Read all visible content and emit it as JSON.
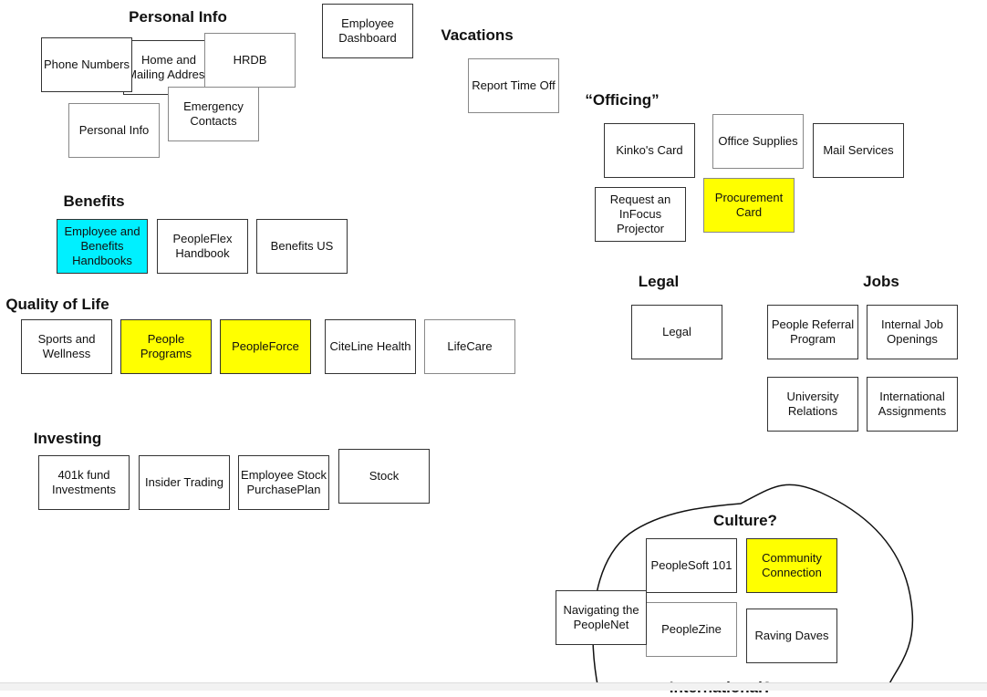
{
  "headings": {
    "personal_info": "Personal Info",
    "vacations": "Vacations",
    "officing": "“Officing”",
    "benefits": "Benefits",
    "quality_of_life": "Quality of Life",
    "investing": "Investing",
    "legal": "Legal",
    "jobs": "Jobs",
    "culture": "Culture?",
    "international": "International?"
  },
  "cards": {
    "home_mailing": "Home and Mailing Address",
    "emergency": "Emergency Contacts",
    "phone": "Phone Numbers",
    "hrdb": "HRDB",
    "personal_info": "Personal Info",
    "employee_dashboard": "Employee Dashboard",
    "report_time_off": "Report Time Off",
    "kinkos": "Kinko's Card",
    "office_supplies": "Office Supplies",
    "mail_services": "Mail Services",
    "infocus": "Request an InFocus Projector",
    "procurement": "Procurement Card",
    "handbooks": "Employee and Benefits Handbooks",
    "peopleflex": "PeopleFlex Handbook",
    "benefits_us": "Benefits US",
    "sports": "Sports and Wellness",
    "people_programs": "People Programs",
    "peopleforce": "PeopleForce",
    "citeline": "CiteLine Health",
    "lifecare": "LifeCare",
    "legal": "Legal",
    "referral": "People Referral Program",
    "internal_jobs": "Internal Job Openings",
    "university": "University Relations",
    "intl_assignments": "International Assignments",
    "k401": "401k fund Investments",
    "insider": "Insider Trading",
    "espp": "Employee Stock PurchasePlan",
    "stock": "Stock",
    "peoplesoft101": "PeopleSoft 101",
    "community": "Community Connection",
    "navigating": "Navigating the PeopleNet",
    "peoplezine": "PeopleZine",
    "raving": "Raving Daves"
  },
  "colors": {
    "highlight_yellow": "#ffff00",
    "highlight_cyan": "#00f0ff"
  }
}
